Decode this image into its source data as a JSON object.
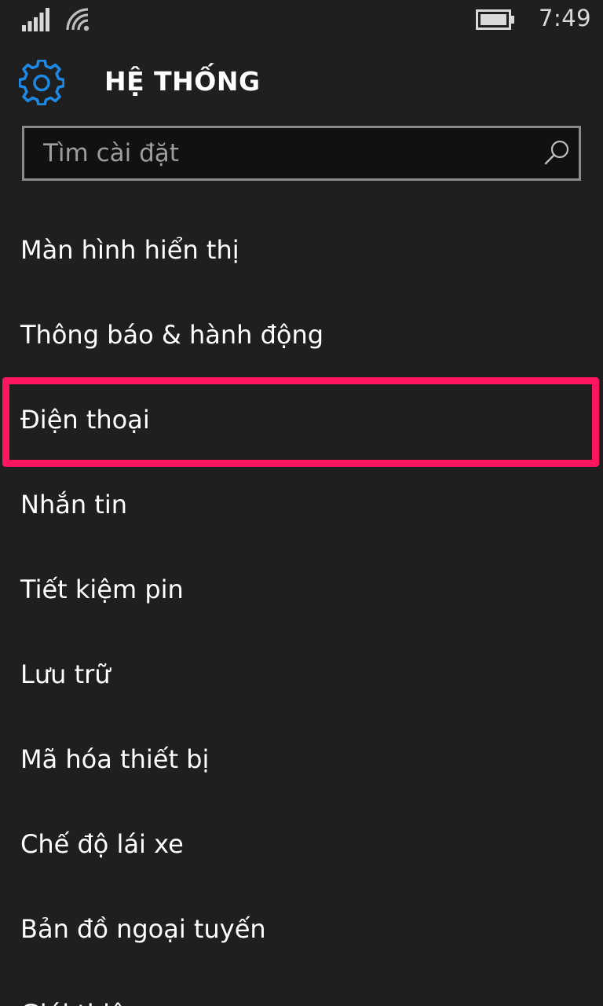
{
  "status_bar": {
    "time": "7:49",
    "icons": [
      "signal-icon",
      "wifi-icon",
      "battery-icon"
    ]
  },
  "header": {
    "icon": "gear-icon",
    "title": "HỆ THỐNG"
  },
  "search": {
    "placeholder": "Tìm cài đặt",
    "value": "",
    "icon": "search-icon"
  },
  "menu": {
    "items": [
      {
        "label": "Màn hình hiển thị"
      },
      {
        "label": "Thông báo & hành động"
      },
      {
        "label": "Điện thoại"
      },
      {
        "label": "Nhắn tin"
      },
      {
        "label": "Tiết kiệm pin"
      },
      {
        "label": "Lưu trữ"
      },
      {
        "label": "Mã hóa thiết bị"
      },
      {
        "label": "Chế độ lái xe"
      },
      {
        "label": "Bản đồ ngoại tuyến"
      },
      {
        "label": "Giới thiệu"
      }
    ],
    "highlighted_index": 2
  },
  "colors": {
    "background": "#1f1f1f",
    "accent": "#1e88e5",
    "highlight": "#ff1560",
    "search_border": "#8a8a8a"
  }
}
